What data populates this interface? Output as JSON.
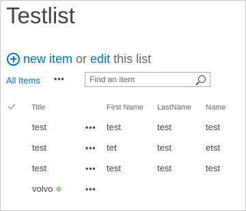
{
  "page": {
    "title": "Testlist"
  },
  "actions": {
    "new_item": "new item",
    "or_text": "or",
    "edit": "edit",
    "this_list": "this list"
  },
  "view": {
    "current": "All Items",
    "more": "•••"
  },
  "search": {
    "placeholder": "Find an item"
  },
  "table": {
    "columns": [
      "Title",
      "First Name",
      "LastName",
      "Name"
    ],
    "rows": [
      {
        "title": "test",
        "menu": "•••",
        "first_name": "test",
        "last_name": "test",
        "name": "test"
      },
      {
        "title": "test",
        "menu": "•••",
        "first_name": "tet",
        "last_name": "test",
        "name": "etst"
      },
      {
        "title": "test",
        "menu": "•••",
        "first_name": "test",
        "last_name": "test",
        "name": "test"
      },
      {
        "title": "volvo",
        "menu": "•••",
        "first_name": "",
        "last_name": "",
        "name": "",
        "new_badge": "✲"
      }
    ]
  },
  "colors": {
    "link": "#0072c6",
    "text": "#444444",
    "new_badge": "#4a9e2a"
  }
}
